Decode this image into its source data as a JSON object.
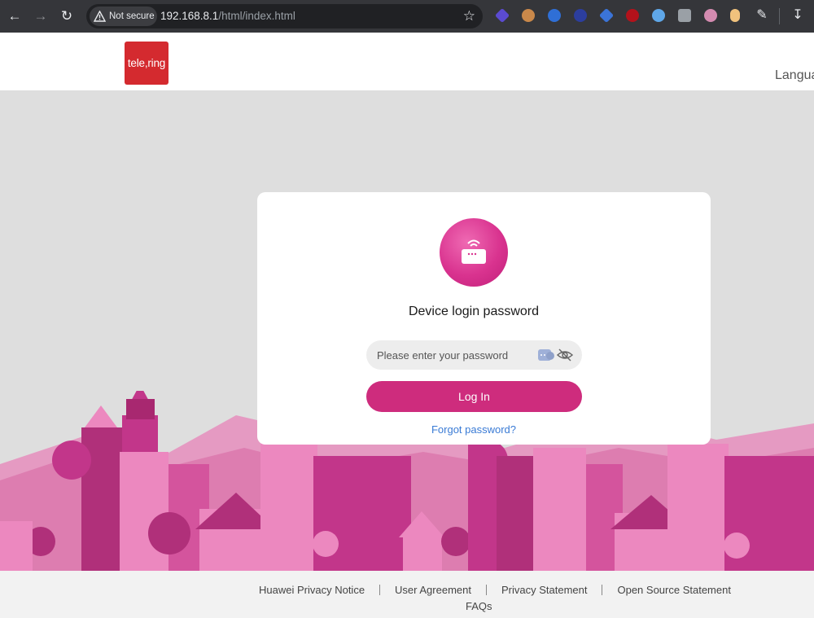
{
  "browser": {
    "security_label": "Not secure",
    "url_host": "192.168.8.1",
    "url_path": "/html/index.html"
  },
  "header": {
    "logo_text": "tele,ring",
    "language_label": "Langua"
  },
  "login": {
    "title": "Device login password",
    "password_placeholder": "Please enter your password",
    "password_value": "",
    "login_button": "Log In",
    "forgot_link": "Forgot password?"
  },
  "footer": {
    "links": [
      "Huawei Privacy Notice",
      "User Agreement",
      "Privacy Statement",
      "Open Source Statement"
    ],
    "faqs": "FAQs"
  },
  "colors": {
    "brand_pink": "#ce2c7d",
    "logo_red": "#d42a2f",
    "link_blue": "#3a7bd5"
  }
}
